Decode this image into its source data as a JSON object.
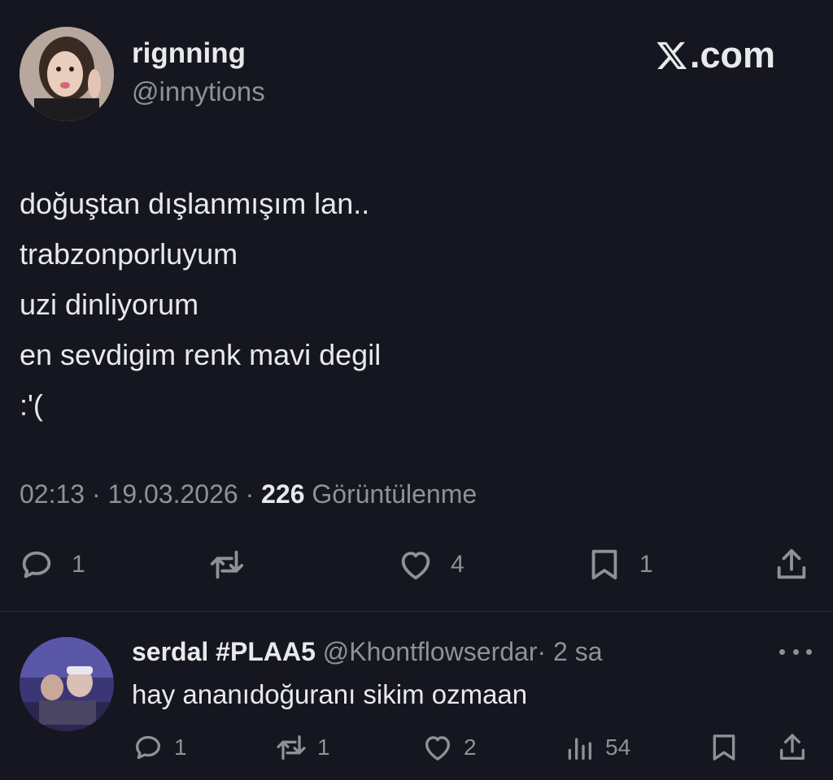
{
  "tweet": {
    "author": {
      "name": "rignning",
      "handle": "@innytions",
      "avatar": "profile-photo"
    },
    "brand": {
      "label": "X.com",
      "icon": "x-logo-icon"
    },
    "lines": [
      "doğuştan dışlanmışım lan..",
      "trabzonporluyum",
      "uzi dinliyorum",
      "en sevdigim renk mavi degil",
      ":'("
    ],
    "meta": {
      "time": "02:13",
      "sep1": " · ",
      "date": "19.03.2026",
      "sep2": " · ",
      "views": "226",
      "views_label": " Görüntülenme"
    },
    "actions": {
      "reply": {
        "icon": "reply-bubble-icon",
        "count": "1"
      },
      "retweet": {
        "icon": "retweet-icon",
        "count": ""
      },
      "like": {
        "icon": "heart-icon",
        "count": "4"
      },
      "bookmark": {
        "icon": "bookmark-icon",
        "count": "1"
      },
      "share": {
        "icon": "share-icon"
      }
    }
  },
  "reply": {
    "author": {
      "name": "serdal #PLAA5",
      "handle": "@Khontflowserdar",
      "dot": "·",
      "time": "2 sa",
      "avatar": "profile-photo"
    },
    "text": "hay ananıdoğuranı sikim ozmaan",
    "more_icon": "more-dots-icon",
    "actions": {
      "reply": {
        "icon": "reply-bubble-icon",
        "count": "1"
      },
      "retweet": {
        "icon": "retweet-icon",
        "count": "1"
      },
      "like": {
        "icon": "heart-icon",
        "count": "2"
      },
      "views": {
        "icon": "views-chart-icon",
        "count": "54"
      },
      "bookmark": {
        "icon": "bookmark-icon"
      },
      "share": {
        "icon": "share-icon"
      }
    }
  },
  "colors": {
    "background": "#15161f",
    "text_primary": "#e8e9ea",
    "text_secondary": "#8d9299",
    "divider": "#2d3036"
  }
}
